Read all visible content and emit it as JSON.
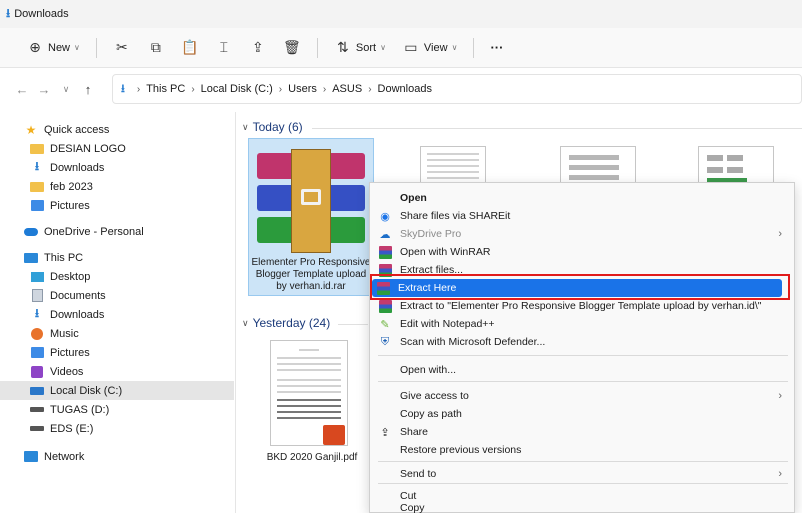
{
  "window": {
    "title": "Downloads"
  },
  "toolbar": {
    "new_label": "New",
    "sort_label": "Sort",
    "view_label": "View",
    "more_label": "···"
  },
  "address": {
    "crumbs": [
      "This PC",
      "Local Disk (C:)",
      "Users",
      "ASUS",
      "Downloads"
    ]
  },
  "sidebar": {
    "quick_access": "Quick access",
    "items": [
      "DESIAN LOGO",
      "Downloads",
      "feb 2023",
      "Pictures"
    ],
    "onedrive": "OneDrive - Personal",
    "this_pc": "This PC",
    "pc_items": [
      "Desktop",
      "Documents",
      "Downloads",
      "Music",
      "Pictures",
      "Videos",
      "Local Disk (C:)",
      "TUGAS (D:)",
      "EDS (E:)"
    ],
    "network": "Network"
  },
  "groups": {
    "today": "Today (6)",
    "yesterday": "Yesterday (24)"
  },
  "files": {
    "selected_name": "Elementer Pro Responsive Blogger Template upload by verhan.id.rar",
    "pdf_name": "BKD 2020 Ganjil.pdf"
  },
  "context_menu": {
    "open": "Open",
    "shareit": "Share files via SHAREit",
    "skydrive": "SkyDrive Pro",
    "open_winrar": "Open with WinRAR",
    "extract_files": "Extract files...",
    "extract_here": "Extract Here",
    "extract_to": "Extract to \"Elementer Pro Responsive Blogger Template upload by verhan.id\\\"",
    "notepad": "Edit with Notepad++",
    "defender": "Scan with Microsoft Defender...",
    "open_with": "Open with...",
    "give_access": "Give access to",
    "copy_path": "Copy as path",
    "share": "Share",
    "restore": "Restore previous versions",
    "send_to": "Send to",
    "cut": "Cut",
    "copy": "Copy"
  },
  "colors": {
    "highlight": "#1a73e8",
    "annotation": "#e11b1b",
    "selection_bg": "#cce4f7"
  }
}
